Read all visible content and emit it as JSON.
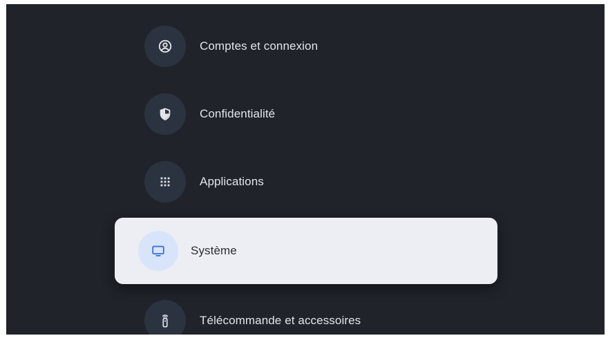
{
  "settings_menu": {
    "items": [
      {
        "label": "Comptes et connexion",
        "icon": "account-circle-icon",
        "selected": false
      },
      {
        "label": "Confidentialité",
        "icon": "shield-icon",
        "selected": false
      },
      {
        "label": "Applications",
        "icon": "apps-grid-icon",
        "selected": false
      },
      {
        "label": "Système",
        "icon": "tv-monitor-icon",
        "selected": true
      },
      {
        "label": "Télécommande et accessoires",
        "icon": "remote-control-icon",
        "selected": false
      }
    ]
  },
  "colors": {
    "background": "#20232a",
    "icon_circle": "#2c3340",
    "selected_card": "#eceef3",
    "selected_icon_circle": "#d8e4fa",
    "accent_blue": "#3b6fd8"
  }
}
